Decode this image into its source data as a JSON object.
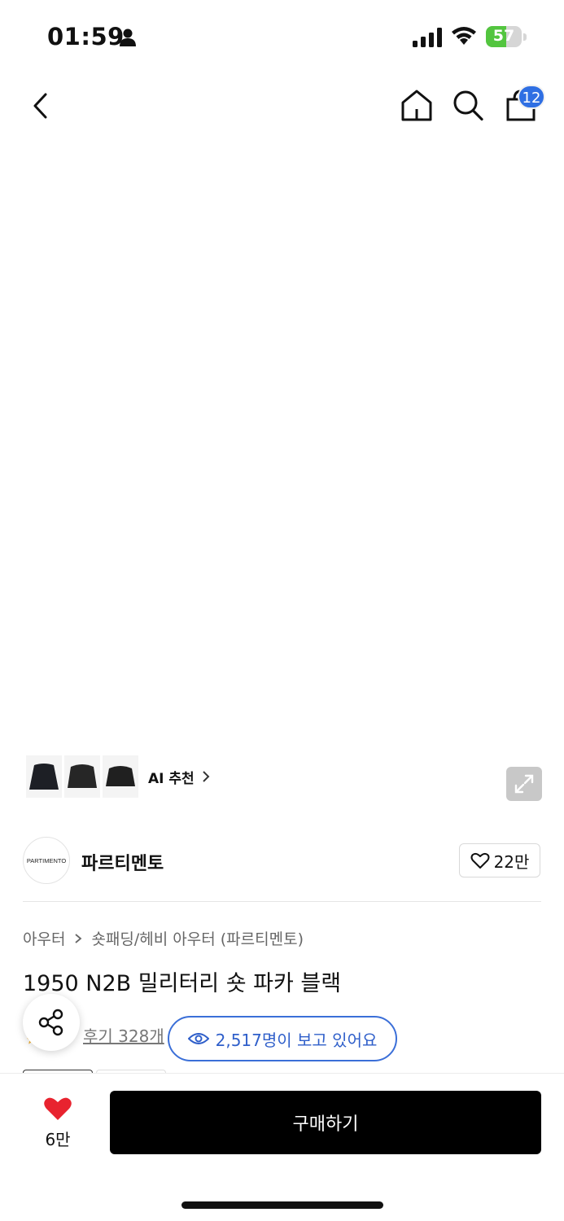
{
  "status_bar": {
    "time": "01:59",
    "battery_level": "57",
    "battery_fraction": 0.57,
    "battery_color": "#53c53f"
  },
  "nav": {
    "back_icon": "chevron-left-icon",
    "home_icon": "home-icon",
    "search_icon": "search-icon",
    "cart_icon": "shopping-bag-icon",
    "cart_count": "12",
    "badge_color": "#2f6fe3"
  },
  "gallery": {
    "ai_recommend_label": "AI 추천",
    "expand_icon": "expand-icon"
  },
  "brand": {
    "logo_text": "PARTIMENTO",
    "name": "파르티멘토",
    "like_count": "22만"
  },
  "product": {
    "breadcrumb": [
      "아우터",
      "숏패딩/헤비 아우터 (파르티멘토)"
    ],
    "title": "1950 N2B 밀리터리 숏 파카 블랙",
    "review_text": "후기 328개",
    "viewers_text": "2,517명이 보고 있어요",
    "accent_color": "#3b6fd8"
  },
  "bottom_bar": {
    "wish_count": "6만",
    "wish_color": "#e8232f",
    "buy_label": "구매하기"
  }
}
